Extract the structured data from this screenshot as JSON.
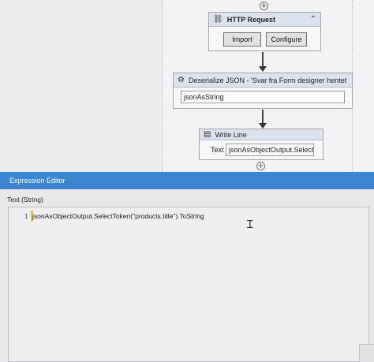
{
  "workflow": {
    "http_request": {
      "title": "HTTP Request",
      "icon": "http-request-icon",
      "import_label": "Import",
      "configure_label": "Configure"
    },
    "deserialize": {
      "title": "Deserialize JSON - 'Svar fra Form designer hentet via",
      "icon": "deserialize-json-icon",
      "value": "jsonAsString"
    },
    "write_line": {
      "title": "Write Line",
      "icon": "write-line-icon",
      "text_label": "Text",
      "text_value": "jsonAsObjectOutput.SelectTc"
    }
  },
  "editor": {
    "title": "Expression Editor",
    "type_label": "Text (String)",
    "line_number": "1",
    "code": "jsonAsObjectOutput.SelectToken(\"products.title\").ToString"
  },
  "colors": {
    "editor_title_bar": "#3d86cf",
    "activity_header": "#dde3ee",
    "canvas": "#f3f3f5"
  }
}
